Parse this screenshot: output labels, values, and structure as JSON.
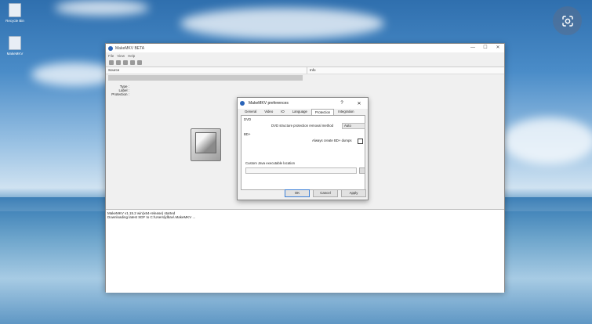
{
  "desktop": {
    "icons": [
      {
        "label": "Recycle Bin",
        "icon": "recycle-bin-icon"
      },
      {
        "label": "MakeMKV",
        "icon": "shortcut-icon"
      }
    ],
    "lens_icon": "google-lens-icon"
  },
  "app": {
    "title": "MakeMKV BETA",
    "window_controls": [
      "—",
      "☐",
      "✕"
    ],
    "menu": [
      "File",
      "View",
      "Help"
    ],
    "source_header": "Source",
    "info_header": "Info",
    "fields": [
      "Type :",
      "Label :",
      "Protection :"
    ],
    "log_lines": [
      "MakeMKV v1.15.2 win(x64-release) started",
      "Downloading latest SDF to C:\\Users\\jdbav\\.MakeMKV ..."
    ]
  },
  "preferences": {
    "title": "MakeMKV preferences",
    "help": "?",
    "close": "✕",
    "tabs": [
      "General",
      "Video",
      "IO",
      "Language",
      "Protection",
      "Integration"
    ],
    "active_tab": "Protection",
    "dvd_heading": "DVD",
    "dvd_method_label": "DVD structure protection removal method",
    "dvd_method_value": "Auto",
    "bd_heading": "BD+",
    "bd_dump_label": "Always create BD+ dumps",
    "java_label": "Custom Java executable location",
    "buttons": {
      "ok": "OK",
      "cancel": "Cancel",
      "apply": "Apply"
    }
  }
}
